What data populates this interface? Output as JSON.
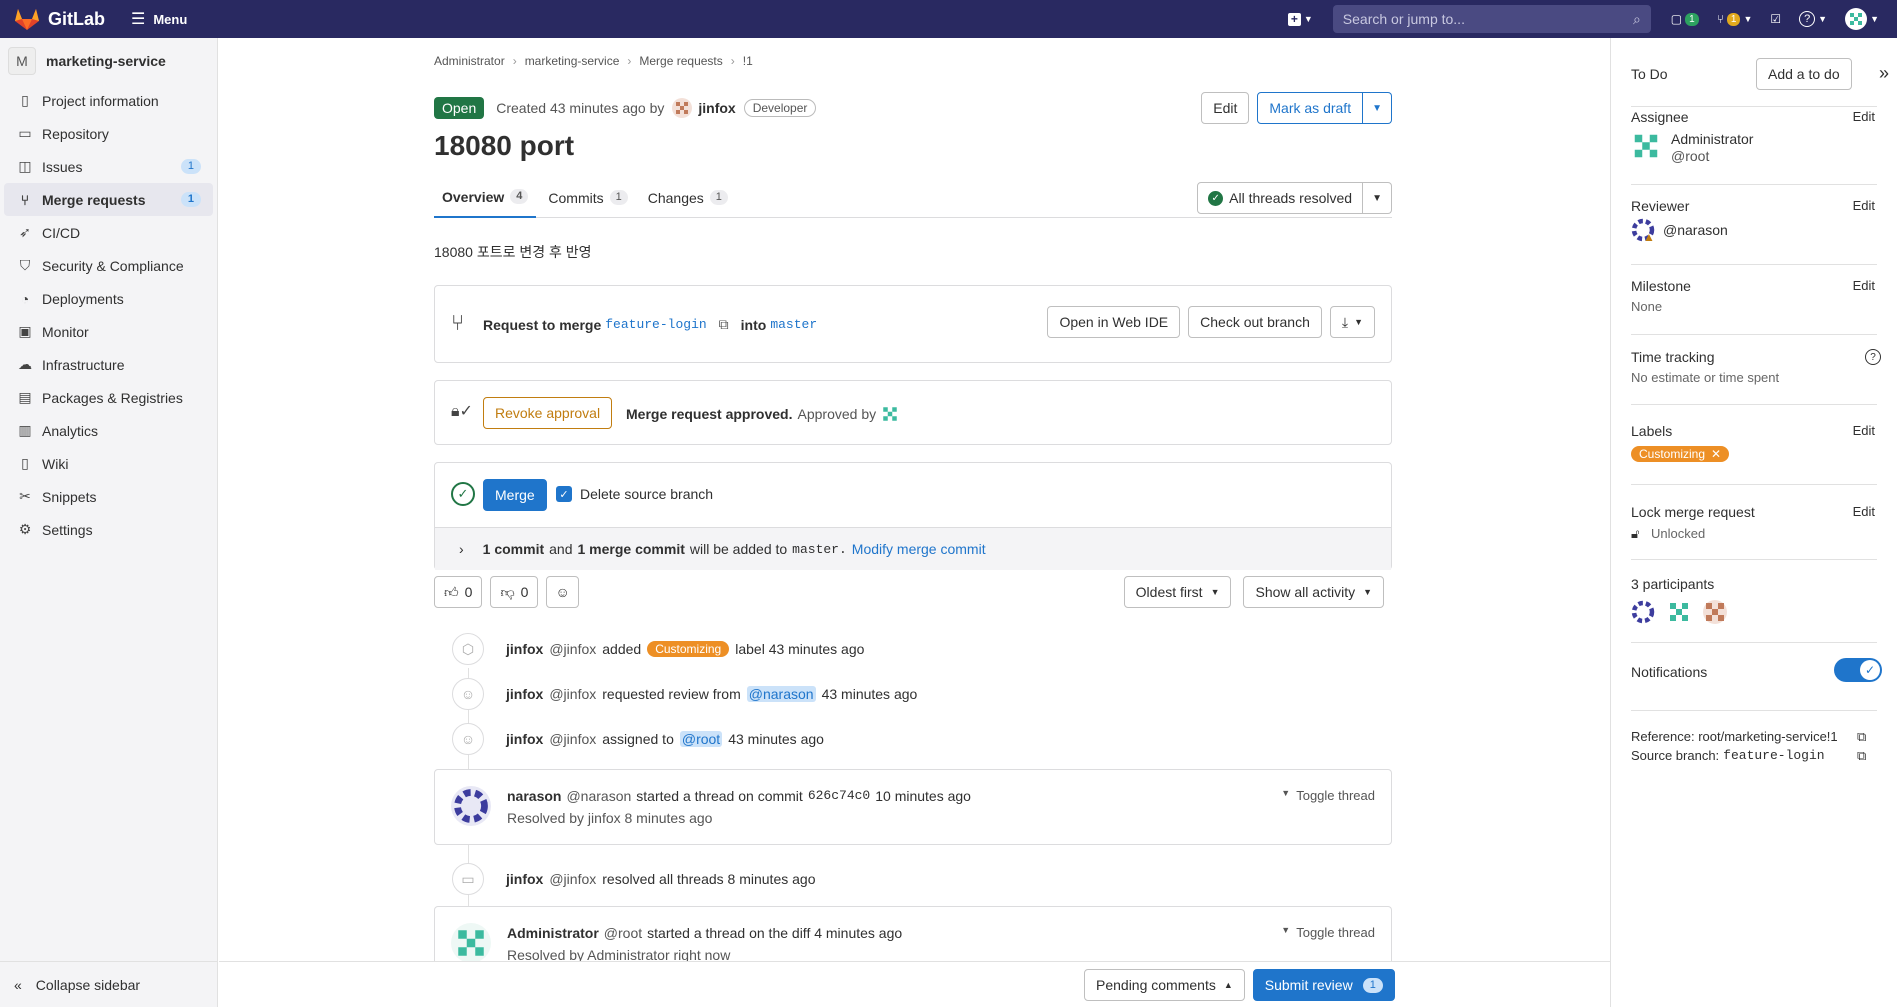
{
  "topbar": {
    "brand": "GitLab",
    "menu_label": "Menu",
    "search_placeholder": "Search or jump to...",
    "issues_count": "1",
    "mr_count": "1"
  },
  "sidebar": {
    "project_initial": "M",
    "project_name": "marketing-service",
    "items": [
      {
        "label": "Project information"
      },
      {
        "label": "Repository"
      },
      {
        "label": "Issues",
        "count": "1"
      },
      {
        "label": "Merge requests",
        "count": "1"
      },
      {
        "label": "CI/CD"
      },
      {
        "label": "Security & Compliance"
      },
      {
        "label": "Deployments"
      },
      {
        "label": "Monitor"
      },
      {
        "label": "Infrastructure"
      },
      {
        "label": "Packages & Registries"
      },
      {
        "label": "Analytics"
      },
      {
        "label": "Wiki"
      },
      {
        "label": "Snippets"
      },
      {
        "label": "Settings"
      }
    ],
    "collapse_label": "Collapse sidebar"
  },
  "breadcrumb": [
    "Administrator",
    "marketing-service",
    "Merge requests",
    "!1"
  ],
  "header": {
    "status": "Open",
    "created_text": "Created 43 minutes ago by",
    "author": "jinfox",
    "role": "Developer",
    "edit_label": "Edit",
    "draft_label": "Mark as draft"
  },
  "title": "18080 port",
  "tabs": [
    {
      "label": "Overview",
      "count": "4"
    },
    {
      "label": "Commits",
      "count": "1"
    },
    {
      "label": "Changes",
      "count": "1"
    }
  ],
  "threads_resolved": "All threads resolved",
  "description": "18080 포트로 변경 후 반영",
  "merge_info": {
    "request_label": "Request to merge",
    "source": "feature-login",
    "into_label": "into",
    "target": "master",
    "web_ide": "Open in Web IDE",
    "checkout": "Check out branch"
  },
  "approval": {
    "revoke_label": "Revoke approval",
    "approved_text": "Merge request approved.",
    "approved_by": "Approved by"
  },
  "merge": {
    "button": "Merge",
    "delete_branch": "Delete source branch",
    "commits_bold1": "1 commit",
    "and": "and",
    "commits_bold2": "1 merge commit",
    "will_add": "will be added to",
    "branch": "master.",
    "modify_link": "Modify merge commit"
  },
  "reactions": {
    "thumbs_up": "0",
    "thumbs_down": "0"
  },
  "activity": {
    "sort": "Oldest first",
    "filter": "Show all activity"
  },
  "timeline": [
    {
      "user": "jinfox",
      "handle": "@jinfox",
      "pre": "added",
      "label": "Customizing",
      "post": "label 43 minutes ago"
    },
    {
      "user": "jinfox",
      "handle": "@jinfox",
      "pre": "requested review from",
      "mention": "@narason",
      "post": "43 minutes ago"
    },
    {
      "user": "jinfox",
      "handle": "@jinfox",
      "pre": "assigned to",
      "mention": "@root",
      "post": "43 minutes ago"
    },
    {
      "user": "jinfox",
      "handle": "@jinfox",
      "pre": "resolved all threads 8 minutes ago"
    }
  ],
  "threads": [
    {
      "user": "narason",
      "handle": "@narason",
      "text": "started a thread on commit",
      "commit": "626c74c0",
      "time": "10 minutes ago",
      "resolved": "Resolved by jinfox 8 minutes ago",
      "toggle": "Toggle thread"
    },
    {
      "user": "Administrator",
      "handle": "@root",
      "text": "started a thread on the diff 4 minutes ago",
      "commit": "",
      "time": "",
      "resolved": "Resolved by Administrator right now",
      "toggle": "Toggle thread"
    }
  ],
  "footer": {
    "pending": "Pending comments",
    "submit": "Submit review",
    "submit_count": "1"
  },
  "right_sidebar": {
    "todo_label": "To Do",
    "add_todo": "Add a to do",
    "assignee_label": "Assignee",
    "assignee_name": "Administrator",
    "assignee_handle": "@root",
    "reviewer_label": "Reviewer",
    "reviewer_handle": "@narason",
    "milestone_label": "Milestone",
    "milestone_value": "None",
    "time_label": "Time tracking",
    "time_value": "No estimate or time spent",
    "labels_label": "Labels",
    "label_value": "Customizing",
    "lock_label": "Lock merge request",
    "lock_value": "Unlocked",
    "participants_label": "3 participants",
    "notifications_label": "Notifications",
    "reference": "Reference: root/marketing-service!1",
    "source_branch_label": "Source branch:",
    "source_branch": "feature-login",
    "edit": "Edit"
  },
  "colors": {
    "topbar": "#292961",
    "open": "#217645",
    "accent": "#1f75cb",
    "label": "#ed8f25",
    "revoke": "#c17d10"
  }
}
